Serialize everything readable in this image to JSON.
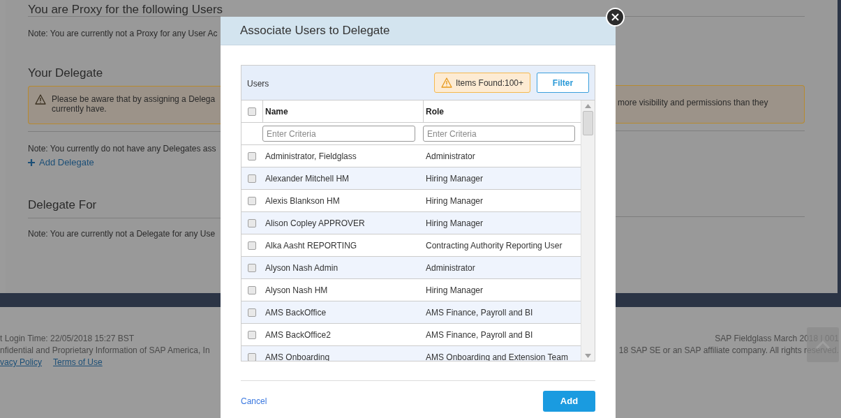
{
  "background": {
    "proxy_section": {
      "title": "You are Proxy for the following Users",
      "note": "Note: You are currently not a Proxy for any User Ac"
    },
    "delegate_section": {
      "title": "Your Delegate",
      "warning_left": [
        "Please be aware that by assigning a Delega",
        "currently have."
      ],
      "warning_right": "more visibility and permissions than they",
      "note": "Note: You currently do not have any Delegates ass",
      "add_link": "Add Delegate"
    },
    "delegate_for_section": {
      "title": "Delegate For",
      "note": "Note: You are currently not a Delegate for any Use"
    },
    "footer": {
      "login_time": "t Login Time: 22/05/2018 15:27 BST",
      "confidential": "nfidential and Proprietary Information of SAP America, In",
      "links": [
        "vacy Policy",
        "Terms of Use"
      ],
      "version": "SAP Fieldglass March 2018 | 001",
      "copyright": "18 SAP SE or an SAP affiliate company. All rights reserved."
    }
  },
  "dialog": {
    "title": "Associate Users to Delegate",
    "table": {
      "title": "Users",
      "items_found": "Items Found:100+",
      "filter_button": "Filter",
      "select_all_checked": false,
      "columns": [
        {
          "label": "Name",
          "placeholder": "Enter Criteria"
        },
        {
          "label": "Role",
          "placeholder": "Enter Criteria"
        }
      ],
      "rows": [
        {
          "name": "Administrator, Fieldglass",
          "role": "Administrator",
          "checked": false
        },
        {
          "name": "Alexander Mitchell HM",
          "role": "Hiring Manager",
          "checked": false
        },
        {
          "name": "Alexis Blankson HM",
          "role": "Hiring Manager",
          "checked": false
        },
        {
          "name": "Alison Copley APPROVER",
          "role": "Hiring Manager",
          "checked": false
        },
        {
          "name": "Alka Aasht REPORTING",
          "role": "Contracting Authority Reporting User",
          "checked": false
        },
        {
          "name": "Alyson Nash Admin",
          "role": "Administrator",
          "checked": false
        },
        {
          "name": "Alyson Nash HM",
          "role": "Hiring Manager",
          "checked": false
        },
        {
          "name": "AMS BackOffice",
          "role": "AMS Finance, Payroll and BI",
          "checked": false
        },
        {
          "name": "AMS BackOffice2",
          "role": "AMS Finance, Payroll and BI",
          "checked": false
        },
        {
          "name": "AMS Onboarding",
          "role": "AMS Onboarding and Extension Team",
          "checked": false
        }
      ]
    },
    "cancel": "Cancel",
    "add_button": "Add"
  }
}
